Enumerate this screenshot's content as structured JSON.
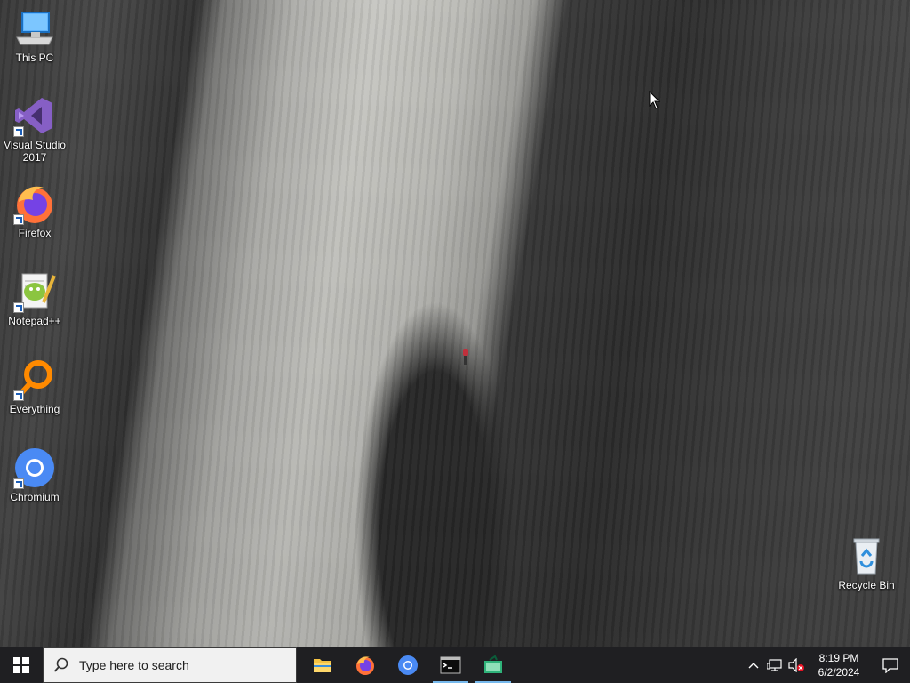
{
  "desktop": {
    "icons": [
      {
        "label": "This PC",
        "icon": "computer-icon",
        "shortcut": false
      },
      {
        "label": "Visual Studio 2017",
        "icon": "visual-studio-icon",
        "shortcut": true
      },
      {
        "label": "Firefox",
        "icon": "firefox-icon",
        "shortcut": true
      },
      {
        "label": "Notepad++",
        "icon": "notepad-plus-plus-icon",
        "shortcut": true
      },
      {
        "label": "Everything",
        "icon": "everything-search-icon",
        "shortcut": true
      },
      {
        "label": "Chromium",
        "icon": "chromium-icon",
        "shortcut": true
      },
      {
        "label": "Recycle Bin",
        "icon": "recycle-bin-icon",
        "shortcut": false
      }
    ]
  },
  "taskbar": {
    "search_placeholder": "Type here to search",
    "pinned_apps": [
      {
        "name": "File Explorer",
        "icon": "folder-icon",
        "running": false
      },
      {
        "name": "Firefox",
        "icon": "firefox-icon",
        "running": false
      },
      {
        "name": "Chromium",
        "icon": "chromium-icon",
        "running": false
      },
      {
        "name": "Command Prompt",
        "icon": "terminal-icon",
        "running": true
      },
      {
        "name": "Screen capture",
        "icon": "screen-capture-icon",
        "running": true
      }
    ],
    "tray": {
      "time": "8:19 PM",
      "date": "6/2/2024"
    }
  },
  "colors": {
    "taskbar_bg": "#1f1f22",
    "accent": "#0078d7",
    "running_indicator": "#76b9ed"
  }
}
